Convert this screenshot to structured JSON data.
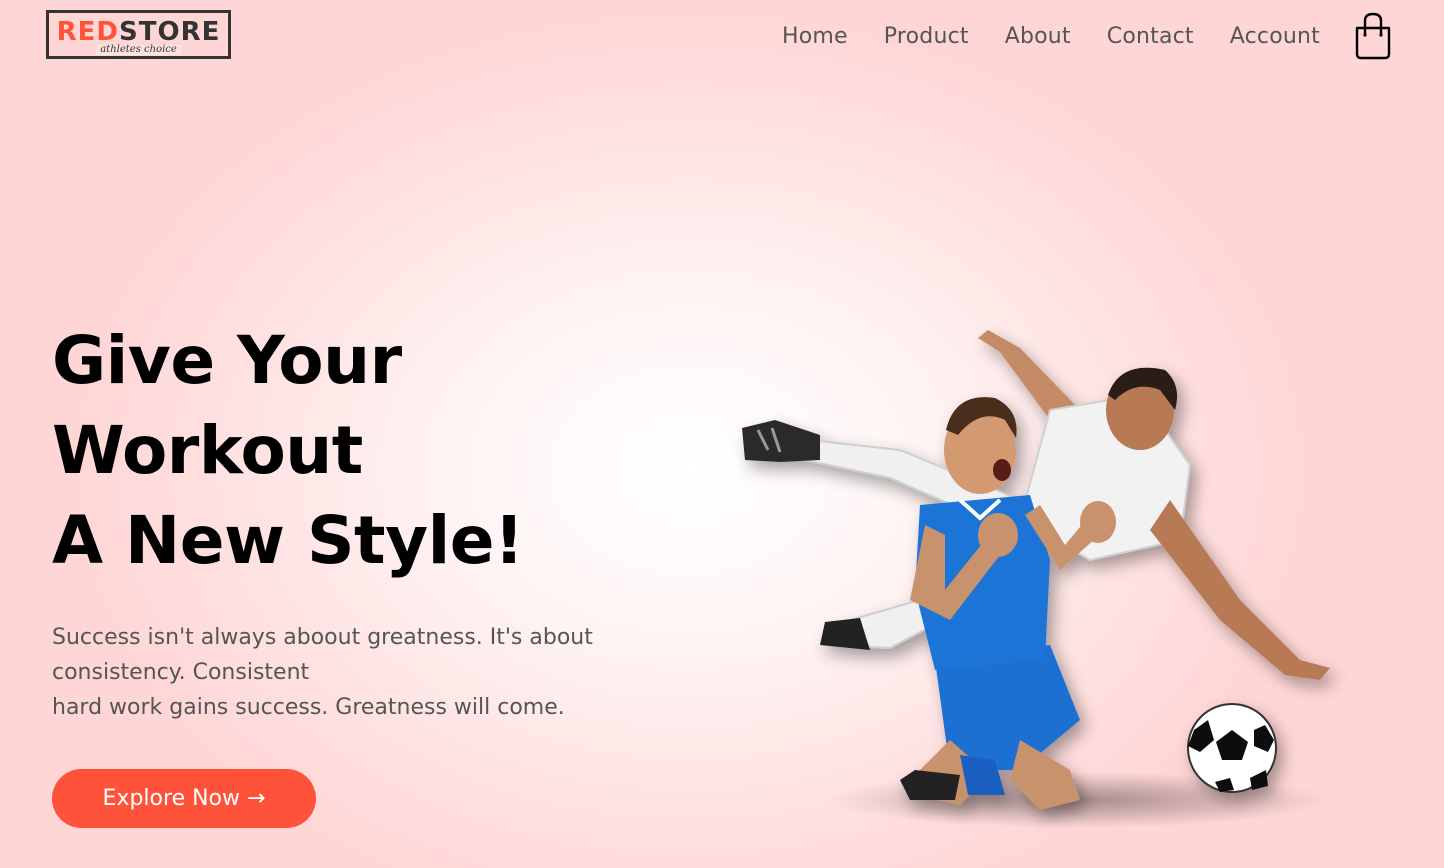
{
  "brand": {
    "logo_part1": "RED",
    "logo_part2": "STORE",
    "tagline": "athletes choice",
    "accent_color": "#ff523b"
  },
  "nav": {
    "items": [
      {
        "label": "Home"
      },
      {
        "label": "Product"
      },
      {
        "label": "About"
      },
      {
        "label": "Contact"
      },
      {
        "label": "Account"
      }
    ],
    "cart_icon": "shopping-bag-icon"
  },
  "hero": {
    "title_lines": [
      "Give Your",
      "Workout",
      "A New Style!"
    ],
    "subtitle_lines": [
      "Success isn't always aboout greatness. It's about",
      "consistency. Consistent",
      "hard work gains success. Greatness will come."
    ],
    "cta_label": "Explore Now →",
    "image_subject": "two-soccer-players-celebrating"
  }
}
